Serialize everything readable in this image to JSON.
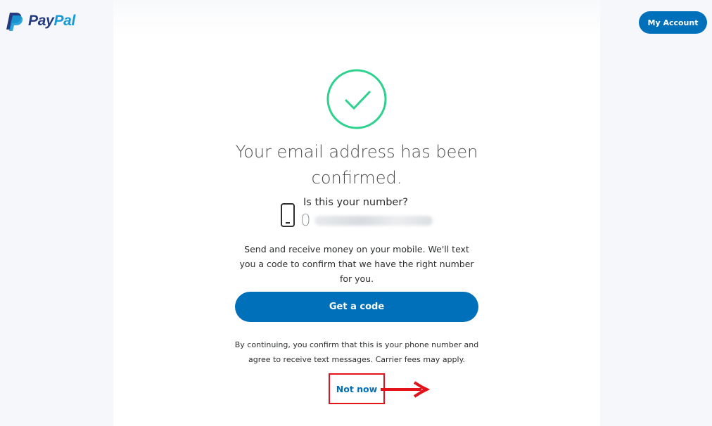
{
  "header": {
    "brand": {
      "part1": "Pay",
      "part2": "Pal",
      "icon": "paypal-p-icon"
    },
    "account_button": "My Account"
  },
  "content": {
    "success_icon": "check-circle-icon",
    "title": "Your email address has been confirmed.",
    "phone_icon": "phone-icon",
    "number_prompt": "Is this your number?",
    "number_visible": "0",
    "description": "Send and receive money on your mobile. We'll text you a code to confirm that we have the right number for you.",
    "primary_button": "Get a code",
    "disclaimer": "By continuing, you confirm that this is your phone number and agree to receive text messages. Carrier fees may apply.",
    "secondary_link": "Not now",
    "annotation_icon": "arrow-right-icon"
  },
  "colors": {
    "brand_blue": "#0070ba",
    "brand_dark": "#253b80",
    "brand_light": "#179bd7",
    "success_green": "#2ed18e",
    "annotation_red": "#e3131b"
  }
}
